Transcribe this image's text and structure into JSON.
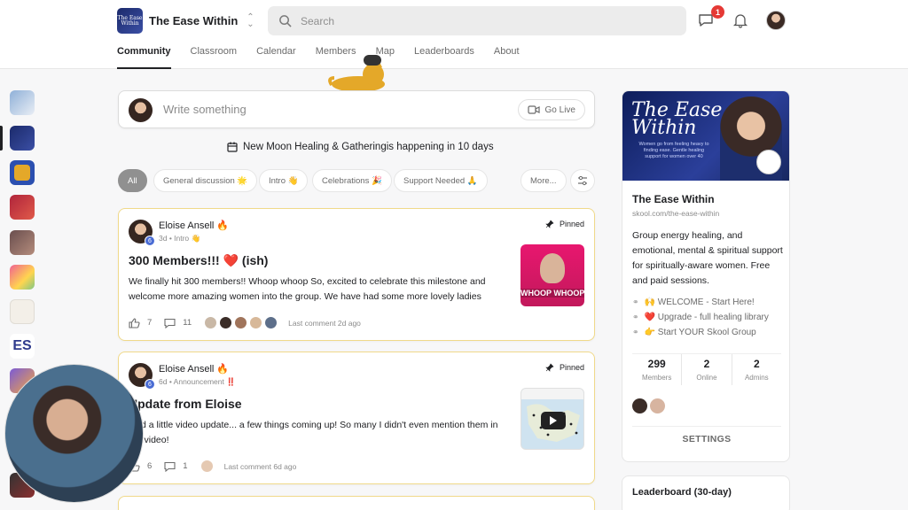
{
  "header": {
    "group_name": "The Ease Within",
    "logo_text": "The Ease Within",
    "search_placeholder": "Search",
    "chat_badge": "1",
    "tabs": [
      {
        "label": "Community"
      },
      {
        "label": "Classroom"
      },
      {
        "label": "Calendar"
      },
      {
        "label": "Members"
      },
      {
        "label": "Map"
      },
      {
        "label": "Leaderboards"
      },
      {
        "label": "About"
      }
    ]
  },
  "composer": {
    "placeholder": "Write something",
    "go_live": "Go Live"
  },
  "event": {
    "name": "New Moon Healing & Gathering",
    "suffix": " is happening in 10 days"
  },
  "filters": [
    {
      "label": "All"
    },
    {
      "label": "General discussion 🌟"
    },
    {
      "label": "Intro 👋"
    },
    {
      "label": "Celebrations 🎉"
    },
    {
      "label": "Support Needed 🙏"
    },
    {
      "label": "More..."
    }
  ],
  "posts": [
    {
      "author": "Eloise Ansell 🔥",
      "level": "6",
      "meta": "3d • Intro 👋",
      "pinned": "Pinned",
      "title": "300 Members!!! ❤️ (ish)",
      "body": "We finally hit 300 members!! Whoop whoop So, excited to celebrate this milestone and welcome more amazing women into the group. We have had some more lovely ladies",
      "likes": "7",
      "comments": "11",
      "last_comment": "Last comment 2d ago",
      "thumb_text": "WHOOP WHOOP"
    },
    {
      "author": "Eloise Ansell 🔥",
      "level": "6",
      "meta": "6d • Announcement ‼️",
      "pinned": "Pinned",
      "title": "Update from Eloise",
      "body": "I did a little video update... a few things coming up! So many I didn't even mention them in the video!",
      "likes": "6",
      "comments": "1",
      "last_comment": "Last comment 6d ago"
    }
  ],
  "sidebar": {
    "banner_title": "The Ease Within",
    "banner_sub": "Women go from feeling heavy to finding ease. Gentle healing support for women over 40",
    "name": "The Ease Within",
    "url": "skool.com/the-ease-within",
    "description": "Group energy healing, and emotional, mental & spiritual support for spiritually-aware women. Free and paid sessions.",
    "links": [
      {
        "label": "🙌 WELCOME - Start Here!"
      },
      {
        "label": "❤️ Upgrade - full healing library"
      },
      {
        "label": "👉 Start YOUR Skool Group"
      }
    ],
    "counts": [
      {
        "value": "299",
        "label": "Members"
      },
      {
        "value": "2",
        "label": "Online"
      },
      {
        "value": "2",
        "label": "Admins"
      }
    ],
    "settings": "SETTINGS",
    "leaderboard_title": "Leaderboard (30-day)"
  },
  "rail": {
    "es_label": "ES"
  }
}
